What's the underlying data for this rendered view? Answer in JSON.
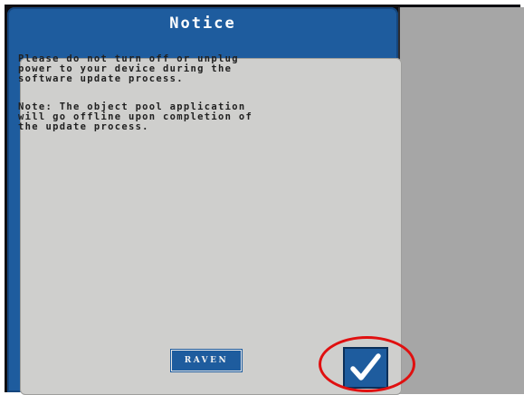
{
  "dialog": {
    "title": "Notice",
    "message_1": "Please do not turn off or unplug\npower to your device during the\nsoftware update process.",
    "message_2": "Note: The object pool application\nwill go offline upon completion of\nthe update process.",
    "logo_text": "Raven",
    "accept_button": {
      "icon": "checkmark-icon"
    }
  },
  "colors": {
    "dialog_blue": "#1e5c9e",
    "body_gray": "#cfcfcd",
    "panel_gray": "#a6a6a6",
    "highlight_red": "#e01010"
  }
}
